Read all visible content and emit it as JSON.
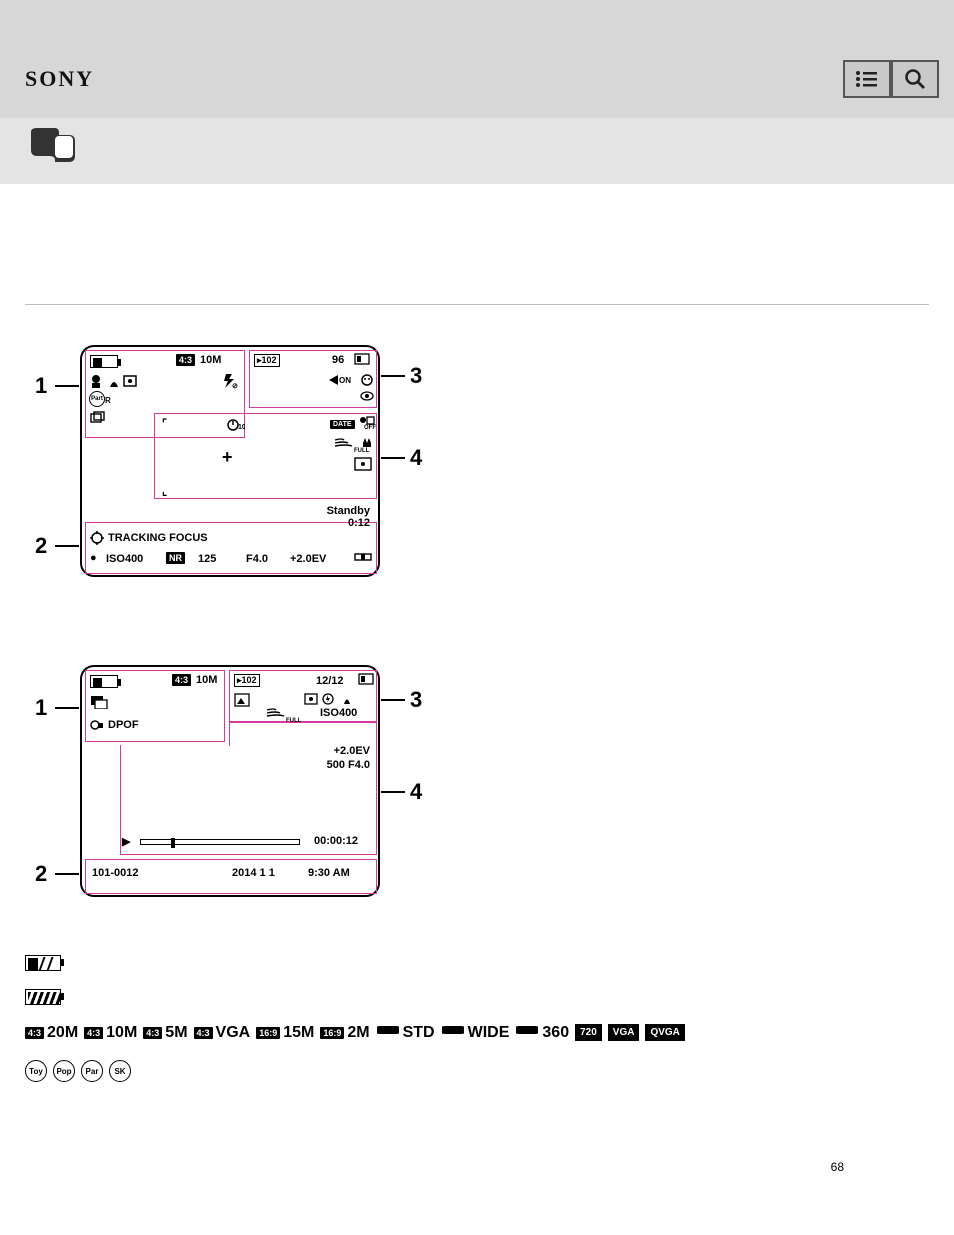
{
  "header": {
    "logo": "SONY"
  },
  "diagram1": {
    "caption": "",
    "zones": {
      "n1": "1",
      "n2": "2",
      "n3": "3",
      "n4": "4"
    },
    "lcd": {
      "ratio_sz": "10M",
      "count": "96",
      "tracking": "TRACKING FOCUS",
      "standby": "Standby",
      "standby_t": "0:12",
      "iso": "ISO400",
      "nr": "NR",
      "shutter": "125",
      "f": "F4.0",
      "ev": "+2.0EV",
      "folder": "102",
      "date": "DATE",
      "timer": "10",
      "ratio": "4:3",
      "kon": "ON",
      "full": "FULL"
    }
  },
  "diagram2": {
    "caption": "",
    "zones": {
      "n1": "1",
      "n2": "2",
      "n3": "3",
      "n4": "4"
    },
    "lcd": {
      "ratio_sz": "10M",
      "count": "12/12",
      "folder": "102",
      "dpof": "DPOF",
      "iso": "ISO400",
      "ev": "+2.0EV",
      "sf": "500 F4.0",
      "elapsed": "00:00:12",
      "file": "101-0012",
      "date": "2014 1 1",
      "time": "9:30 AM",
      "ratio": "4:3",
      "full": "FULL"
    }
  },
  "section1_label": "1",
  "battery": {
    "remaining_note": "",
    "low_warn_note": ""
  },
  "size_row": {
    "items": [
      {
        "ratio": "4:3",
        "sz": "20M"
      },
      {
        "ratio": "4:3",
        "sz": "10M"
      },
      {
        "ratio": "4:3",
        "sz": "5M"
      },
      {
        "ratio": "4:3",
        "sz": "VGA"
      },
      {
        "ratio": "16:9",
        "sz": "15M"
      },
      {
        "ratio": "16:9",
        "sz": "2M"
      }
    ],
    "pano": [
      {
        "lbl": "STD"
      },
      {
        "lbl": "WIDE"
      },
      {
        "lbl": "360"
      }
    ],
    "movie": [
      "720",
      "VGA",
      "QVGA"
    ],
    "note": ""
  },
  "effects": {
    "items": [
      "Toy",
      "Pop",
      "Part",
      "Soft Key"
    ],
    "note": ""
  },
  "page_number": "68"
}
